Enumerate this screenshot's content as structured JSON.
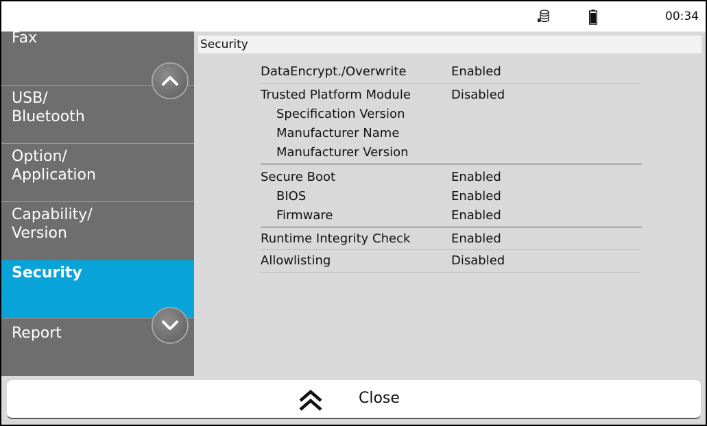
{
  "status_bar": {
    "time": "00:34",
    "icons": [
      "database-icon",
      "battery-icon"
    ]
  },
  "sidebar": {
    "items": [
      {
        "label": "Fax",
        "active": false
      },
      {
        "label": "USB/\nBluetooth",
        "active": false
      },
      {
        "label": "Option/\nApplication",
        "active": false
      },
      {
        "label": "Capability/\nVersion",
        "active": false
      },
      {
        "label": "Security",
        "active": true
      },
      {
        "label": "Report",
        "active": false
      }
    ],
    "scroll_up_icon": "chevron-up-icon",
    "scroll_down_icon": "chevron-down-icon"
  },
  "main": {
    "section_title": "Security",
    "rows": [
      {
        "key": "DataEncrypt./Overwrite",
        "value": "Enabled"
      },
      {
        "key": "Trusted Platform Module",
        "value": "Disabled"
      },
      {
        "key": "Specification Version",
        "value": ""
      },
      {
        "key": "Manufacturer Name",
        "value": ""
      },
      {
        "key": "Manufacturer Version",
        "value": ""
      },
      {
        "key": "Secure Boot",
        "value": "Enabled"
      },
      {
        "key": "BIOS",
        "value": "Enabled"
      },
      {
        "key": "Firmware",
        "value": "Enabled"
      },
      {
        "key": "Runtime Integrity Check",
        "value": "Enabled"
      },
      {
        "key": "Allowlisting",
        "value": "Disabled"
      }
    ]
  },
  "footer": {
    "close_label": "Close",
    "close_icon": "double-chevron-up-icon"
  },
  "colors": {
    "sidebar_bg": "#6e6e6e",
    "active_item_bg": "#08a3d8",
    "content_bg": "#d9d9d9"
  }
}
